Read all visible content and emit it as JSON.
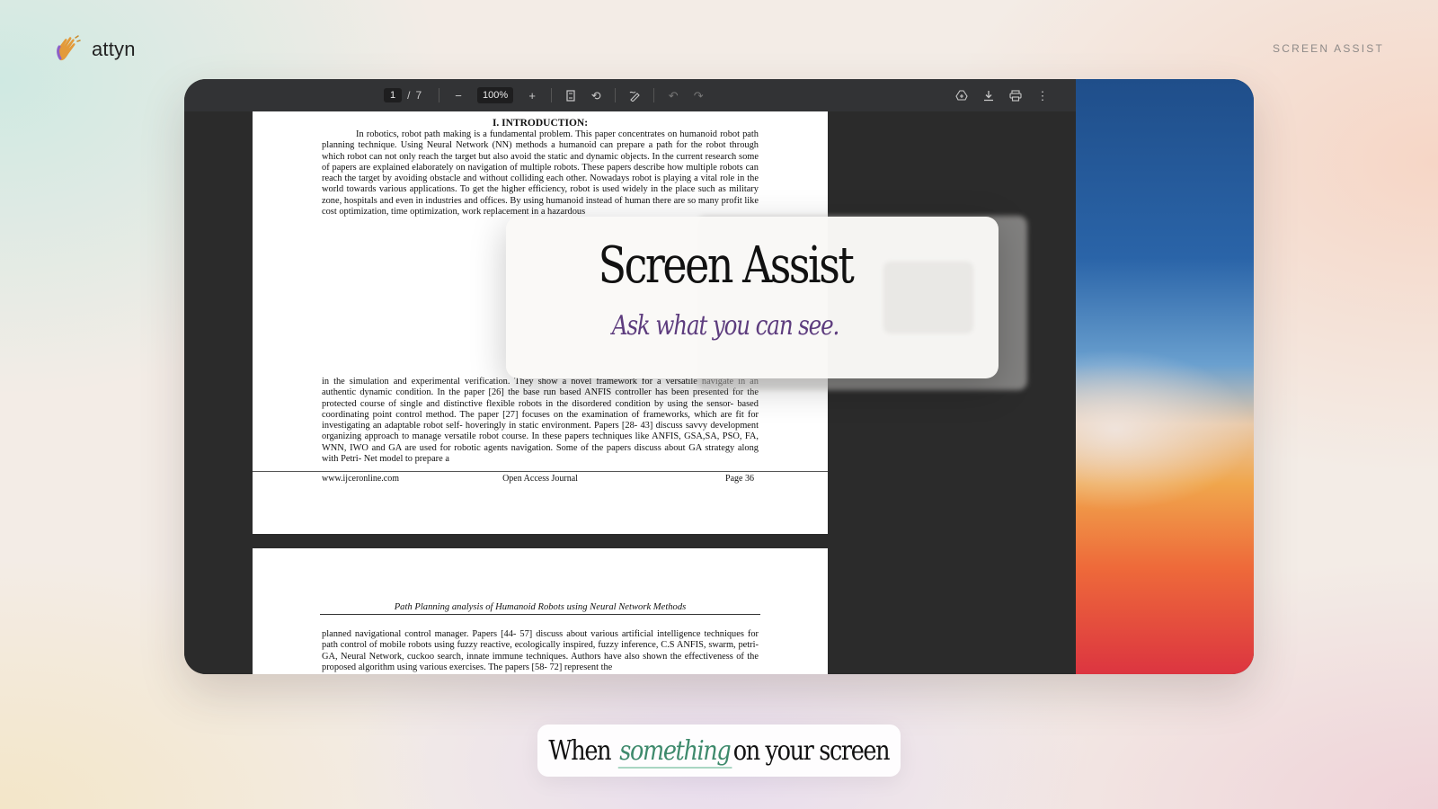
{
  "brand": {
    "name": "attyn",
    "logo_icon": "waving-hand-icon"
  },
  "top_tag": "SCREEN ASSIST",
  "pdf_toolbar": {
    "page_current": "1",
    "page_separator": "/",
    "page_total": "7",
    "zoom": "100%",
    "icons": [
      "zoom-out-icon",
      "zoom-in-icon",
      "fit-page-icon",
      "rotate-icon",
      "annotate-icon",
      "undo-icon",
      "redo-icon",
      "add-to-drive-icon",
      "download-icon",
      "print-icon",
      "more-icon"
    ]
  },
  "page1": {
    "heading": "I.     INTRODUCTION:",
    "paragraph": "In robotics, robot path making is a  fundamental problem. This paper concentrates on humanoid robot path planning technique. Using Neural Network (NN) methods a humanoid can prepare a path for the robot through which robot can not only reach the target but also avoid the static and dynamic objects. In the current research some of papers are explained elaborately on navigation of multiple robots. These papers  describe how multiple robots can reach the target by avoiding obstacle and without colliding each other. Nowadays robot is playing a vital role in the world towards various applications. To get the higher efficiency, robot is used widely in the place such as military zone, hospitals and even in industries and offices. By using humanoid  instead of human there are so many profit like cost optimization, time optimization, work replacement in a hazardous",
    "lower_paragraph": "in the simulation and experimental verification. They show a novel framework for a versatile navigate in an authentic dynamic condition. In the paper [26] the base run based ANFIS controller has been presented for the protected course of single and distinctive flexible robots in the disordered condition by using the sensor-  based coordinating point control method. The paper [27] focuses on the examination of frameworks, which are fit for investigating an adaptable robot self-  hoveringly in static environment. Papers [28-  43] discuss savvy development organizing approach to manage versatile robot course. In these papers techniques like ANFIS, GSA,SA, PSO, FA, WNN, IWO and GA are used for robotic agents navigation. Some of the papers discuss about GA strategy along with Petri-  Net model to prepare a",
    "footer_left": "www.ijceronline.com",
    "footer_center": "Open Access Journal",
    "footer_right": "Page 36"
  },
  "page2": {
    "running_title": "Path Planning analysis of Humanoid Robots using Neural Network Methods",
    "paragraph": "planned navigational control manager. Papers [44-  57] discuss about various artificial intelligence techniques for path control of mobile robots using fuzzy reactive, ecologically inspired, fuzzy inference, C.S ANFIS, swarm, petri-  GA, Neural Network, cuckoo search, innate immune techniques. Authors have also shown the effectiveness of the proposed algorithm using various exercises. The papers [58-  72] represent the"
  },
  "overlay": {
    "title": "Screen Assist",
    "subtitle": "Ask what you can see."
  },
  "caption": {
    "before": "When",
    "emphasis": "something",
    "after": "on your screen"
  }
}
